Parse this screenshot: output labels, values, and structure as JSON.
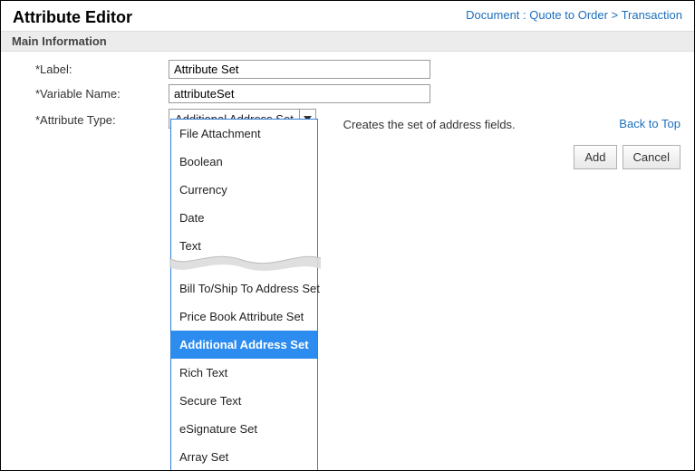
{
  "header": {
    "title": "Attribute Editor"
  },
  "breadcrumb": {
    "prefix": "Document : ",
    "doc": "Quote to Order",
    "sep": " > ",
    "page": "Transaction"
  },
  "section": {
    "main": "Main Information"
  },
  "form": {
    "label": {
      "label": "*Label:",
      "value": "Attribute Set"
    },
    "variable": {
      "label": "*Variable Name:",
      "value": "attributeSet"
    },
    "type": {
      "label": "*Attribute Type:",
      "value": "Additional Address Set",
      "helper": "Creates the set of address fields."
    }
  },
  "dropdown": {
    "group1": [
      {
        "label": "File Attachment",
        "selected": false
      },
      {
        "label": "Boolean",
        "selected": false
      },
      {
        "label": "Currency",
        "selected": false
      },
      {
        "label": "Date",
        "selected": false
      },
      {
        "label": "Text",
        "selected": false
      }
    ],
    "group2": [
      {
        "label": "Bill To/Ship To Address Set",
        "selected": false
      },
      {
        "label": "Price Book Attribute Set",
        "selected": false
      },
      {
        "label": "Additional Address Set",
        "selected": true
      },
      {
        "label": "Rich Text",
        "selected": false
      },
      {
        "label": "Secure Text",
        "selected": false
      },
      {
        "label": "eSignature Set",
        "selected": false
      },
      {
        "label": "Array Set",
        "selected": false
      }
    ]
  },
  "links": {
    "back_to_top": "Back to Top"
  },
  "buttons": {
    "add": "Add",
    "cancel": "Cancel"
  }
}
